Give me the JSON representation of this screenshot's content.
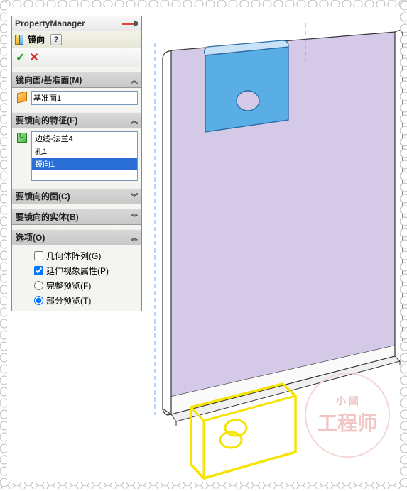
{
  "titlebar": {
    "title": "PropertyManager"
  },
  "feature": {
    "name": "镜向"
  },
  "buttons": {
    "help": "?",
    "ok": "✓",
    "cancel": "✕"
  },
  "groups": {
    "plane": {
      "header": "镜向面/基准面(M)",
      "value": "基准面1"
    },
    "features": {
      "header": "要镜向的特征(F)",
      "items": [
        "边线-法兰4",
        "孔1",
        "镜向1"
      ],
      "selectedIndex": 2
    },
    "faces": {
      "header": "要镜向的面(C)"
    },
    "bodies": {
      "header": "要镜向的实体(B)"
    },
    "options": {
      "header": "选项(O)",
      "geomPattern": {
        "label": "几何体阵列(G)",
        "checked": false
      },
      "propagate": {
        "label": "延伸视象属性(P)",
        "checked": true
      },
      "fullPreview": {
        "label": "完整预览(F)",
        "selected": false
      },
      "partialPreview": {
        "label": "部分预览(T)",
        "selected": true
      }
    }
  },
  "watermark": {
    "small": "小 國",
    "big": "工程师"
  }
}
